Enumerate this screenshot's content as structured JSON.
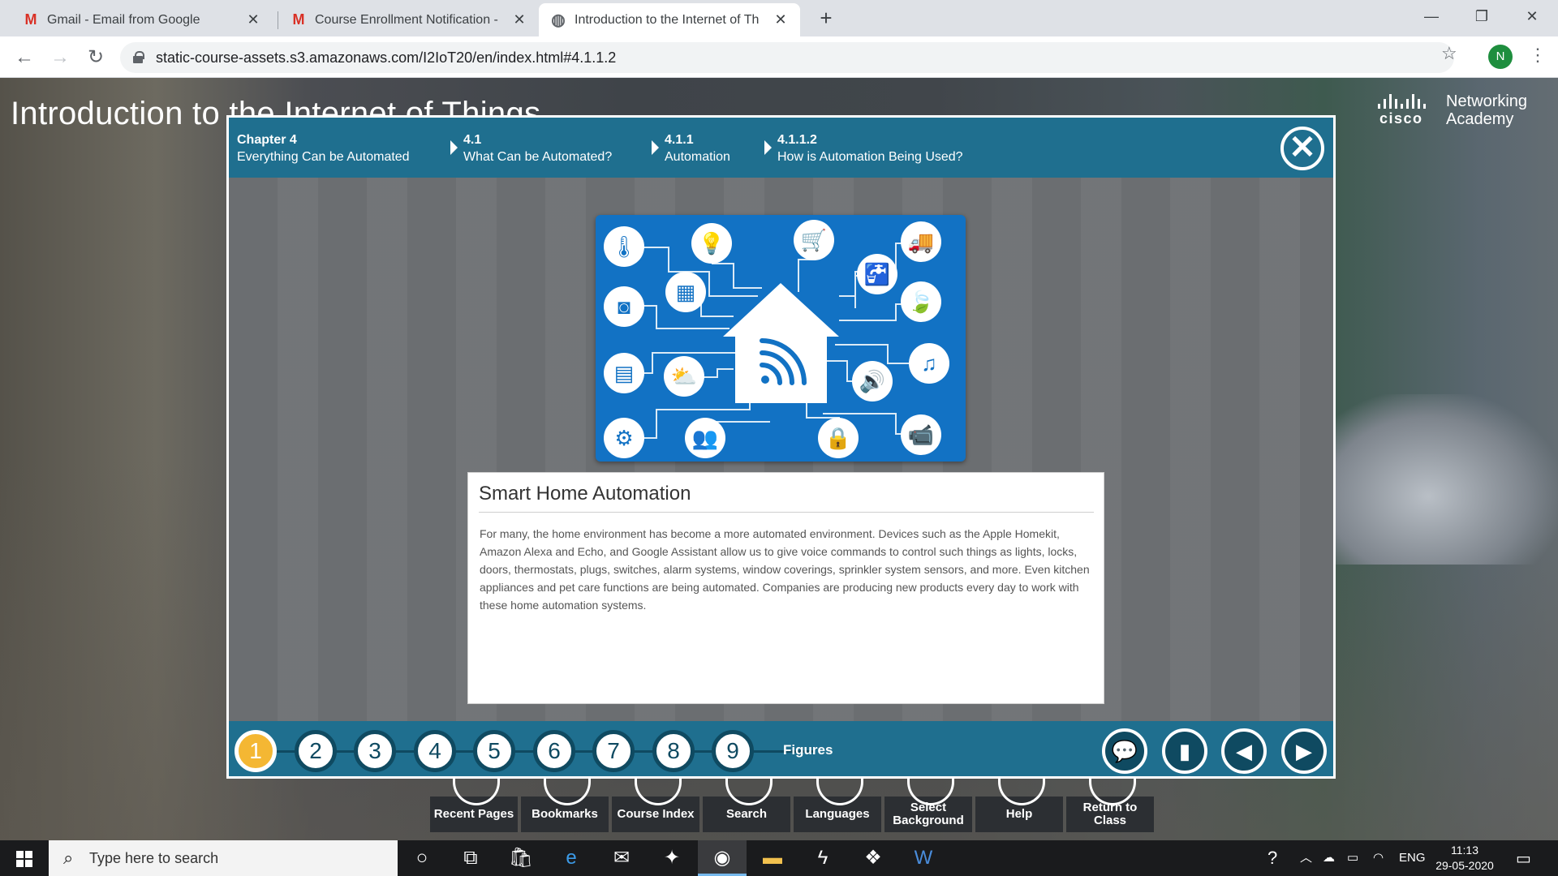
{
  "browser": {
    "tabs": [
      {
        "title": "Gmail - Email from Google",
        "favicon": "gmail-icon",
        "active": false
      },
      {
        "title": "Course Enrollment Notification -",
        "favicon": "gmail-icon",
        "active": false
      },
      {
        "title": "Introduction to the Internet of Th",
        "favicon": "globe-icon",
        "active": true
      }
    ],
    "url": "static-course-assets.s3.amazonaws.com/I2IoT20/en/index.html#4.1.1.2",
    "profile_initial": "N"
  },
  "page": {
    "course_title": "Introduction to the Internet of Things",
    "logo": {
      "brand": "cisco",
      "line1": "Networking",
      "line2": "Academy"
    },
    "bottom_tools": [
      "Recent Pages",
      "Bookmarks",
      "Course Index",
      "Search",
      "Languages",
      "Select Background",
      "Help",
      "Return to Class"
    ]
  },
  "modal": {
    "breadcrumbs": [
      {
        "num": "Chapter 4",
        "label": "Everything Can be Automated"
      },
      {
        "num": "4.1",
        "label": "What Can be Automated?"
      },
      {
        "num": "4.1.1",
        "label": "Automation"
      },
      {
        "num": "4.1.1.2",
        "label": "How is Automation Being Used?"
      }
    ],
    "close_glyph": "✕",
    "graphic_icons": [
      "thermometer-icon",
      "lightbulb-icon",
      "cart-icon",
      "delivery-truck-icon",
      "speaker-box-icon",
      "storefront-icon",
      "faucet-icon",
      "leaf-icon",
      "calendar-icon",
      "weather-icon",
      "volume-icon",
      "music-icon",
      "gears-icon",
      "people-icon",
      "lock-icon",
      "security-camera-icon",
      "smart-home-icon"
    ],
    "content": {
      "title": "Smart Home Automation",
      "body": "For many, the home environment has become a more automated environment. Devices such as the Apple Homekit, Amazon Alexa and Echo, and Google Assistant allow us to give voice commands to control such things as lights, locks, doors, thermostats, plugs, switches, alarm systems, window coverings, sprinkler system sensors, and more. Even kitchen appliances and pet care functions are being automated. Companies are producing new products every day to work with these home automation systems."
    },
    "pages": [
      "1",
      "2",
      "3",
      "4",
      "5",
      "6",
      "7",
      "8",
      "9"
    ],
    "current_page": "1",
    "figures_label": "Figures",
    "footer_buttons": [
      "comment-icon",
      "bookmark-icon",
      "previous-icon",
      "next-icon"
    ]
  },
  "taskbar": {
    "search_placeholder": "Type here to search",
    "language": "ENG",
    "time": "11:13",
    "date": "29-05-2020"
  },
  "colors": {
    "header_teal": "#1f6f8f",
    "graphic_blue": "#1272c4",
    "current_page_gold": "#f4b733"
  }
}
